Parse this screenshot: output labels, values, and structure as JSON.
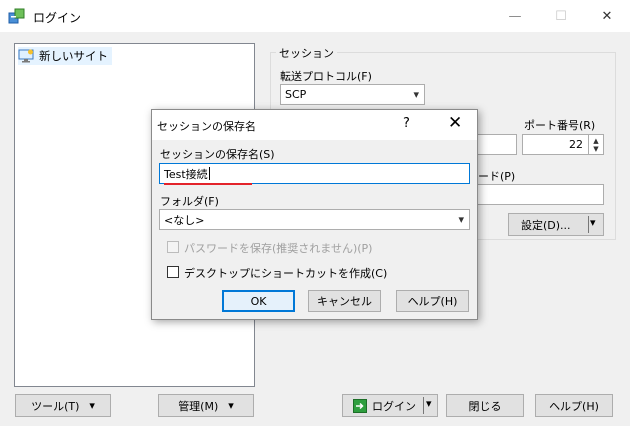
{
  "window": {
    "title": "ログイン",
    "minimize_glyph": "—",
    "maximize_glyph": "☐",
    "close_glyph": "✕"
  },
  "tree": {
    "items": [
      {
        "label": "新しいサイト",
        "icon": "monitor-icon"
      }
    ]
  },
  "session": {
    "group_label": "セッション",
    "protocol_label": "転送プロトコル(F)",
    "protocol_value": "SCP",
    "port_label": "ポート番号(R)",
    "port_value": "22",
    "password_label_fragment": "ード(P)",
    "settings_label": "設定(D)...",
    "dropdown_glyph": "▾"
  },
  "bottom": {
    "tools_label": "ツール(T)",
    "manage_label": "管理(M)",
    "login_label": "ログイン",
    "close_label": "閉じる",
    "help_label": "ヘルプ(H)"
  },
  "dialog": {
    "title": "セッションの保存名",
    "help_glyph": "?",
    "close_glyph": "✕",
    "name_label": "セッションの保存名(S)",
    "name_value": "Test接続",
    "folder_label": "フォルダ(F)",
    "folder_value": "<なし>",
    "save_password_label": "パスワードを保存(推奨されません)(P)",
    "desktop_shortcut_label": "デスクトップにショートカットを作成(C)",
    "ok_label": "OK",
    "cancel_label": "キャンセル",
    "help_label": "ヘルプ(H)"
  },
  "colors": {
    "accent": "#0078d7",
    "annotation_red": "#e3242b",
    "login_icon_green": "#2e9e3e"
  }
}
